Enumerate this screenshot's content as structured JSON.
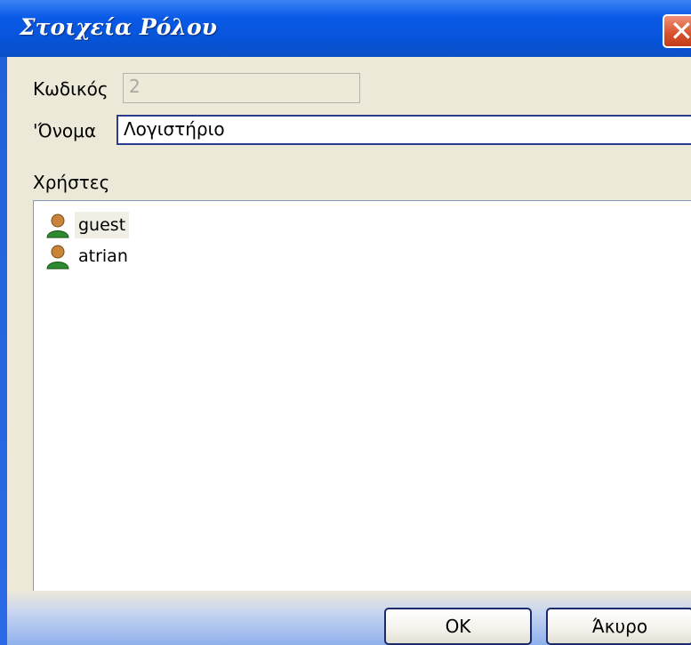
{
  "window": {
    "title": "Στοιχεία Ρόλου",
    "close_icon": "close-icon"
  },
  "form": {
    "code_label": "Κωδικός",
    "code_value": "2",
    "name_label": "'Όνομα",
    "name_value": "Λογιστήριο",
    "users_label": "Χρήστες"
  },
  "users": [
    {
      "name": "guest",
      "icon": "user-icon",
      "selected": true
    },
    {
      "name": "atrian",
      "icon": "user-icon",
      "selected": false
    }
  ],
  "buttons": {
    "ok_label": "OK",
    "cancel_label": "Άκυρο"
  }
}
